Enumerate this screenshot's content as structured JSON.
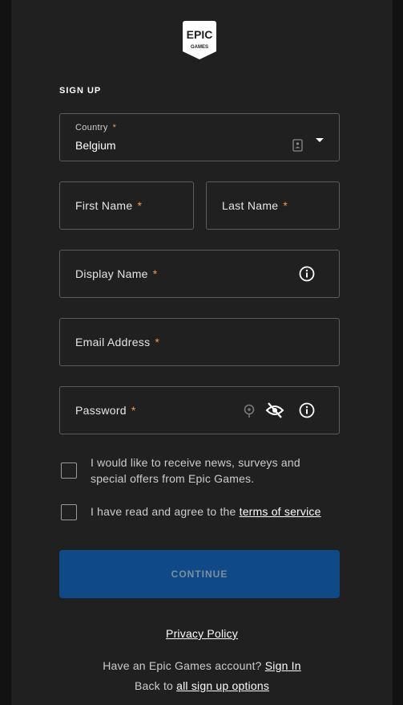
{
  "logo": {
    "line1": "EPIC",
    "line2": "GAMES"
  },
  "heading": "SIGN UP",
  "country": {
    "label": "Country",
    "value": "Belgium",
    "required_mark": "*"
  },
  "first_name": {
    "label": "First Name",
    "required_mark": "*"
  },
  "last_name": {
    "label": "Last Name",
    "required_mark": "*"
  },
  "display_name": {
    "label": "Display Name",
    "required_mark": "*"
  },
  "email": {
    "label": "Email Address",
    "required_mark": "*"
  },
  "password": {
    "label": "Password",
    "required_mark": "*"
  },
  "news_checkbox": {
    "line1": "I would like to receive news, surveys and",
    "line2": "special offers from Epic Games."
  },
  "terms_checkbox": {
    "text": "I have read and agree to the ",
    "link": "terms of service"
  },
  "continue_label": "CONTINUE",
  "privacy_policy": "Privacy Policy",
  "have_account": {
    "text": "Have an Epic Games account? ",
    "link": "Sign In"
  },
  "back_to": {
    "text": "Back to ",
    "link": "all sign up options"
  },
  "colors": {
    "background": "#121212",
    "panel": "#202020",
    "required": "#f2994a",
    "button": "#0f4a86",
    "button_text": "#7d8d9f",
    "field_border": "#5c5c5c"
  },
  "icons": [
    "epic-games-logo",
    "contact-card-icon",
    "dropdown-caret-icon",
    "info-icon",
    "password-key-icon",
    "eye-slash-icon"
  ]
}
